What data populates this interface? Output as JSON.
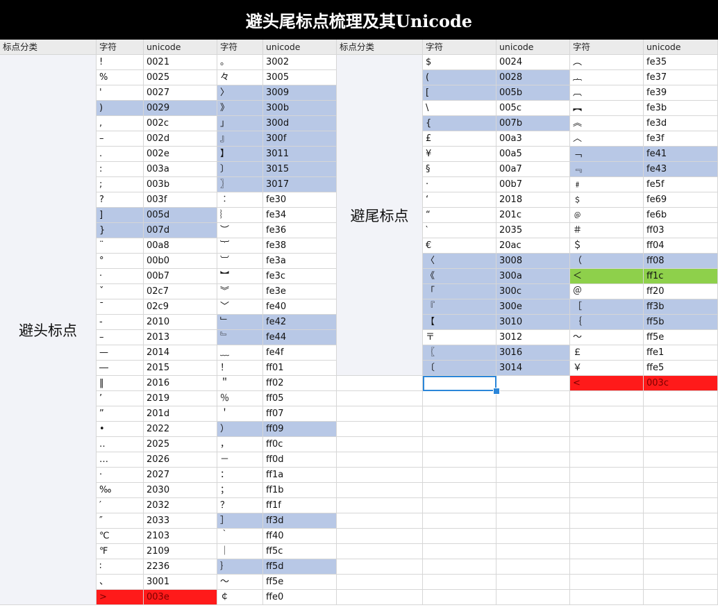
{
  "title": "避头尾标点梳理及其Unicode",
  "headers": {
    "category": "标点分类",
    "char": "字符",
    "unicode": "unicode"
  },
  "head_block": {
    "label": "避头标点",
    "col1": [
      [
        "!",
        "0021",
        ""
      ],
      [
        "%",
        "0025",
        ""
      ],
      [
        "'",
        "0027",
        ""
      ],
      [
        ")",
        "0029",
        "sel"
      ],
      [
        ",",
        "002c",
        ""
      ],
      [
        "–",
        "002d",
        ""
      ],
      [
        ".",
        "002e",
        ""
      ],
      [
        ":",
        "003a",
        ""
      ],
      [
        ";",
        "003b",
        ""
      ],
      [
        "?",
        "003f",
        ""
      ],
      [
        "]",
        "005d",
        "sel"
      ],
      [
        "}",
        "007d",
        "sel"
      ],
      [
        "¨",
        "00a8",
        ""
      ],
      [
        "°",
        "00b0",
        ""
      ],
      [
        "·",
        "00b7",
        ""
      ],
      [
        "ˇ",
        "02c7",
        ""
      ],
      [
        "ˉ",
        "02c9",
        ""
      ],
      [
        "‐",
        "2010",
        ""
      ],
      [
        "–",
        "2013",
        ""
      ],
      [
        "—",
        "2014",
        ""
      ],
      [
        "―",
        "2015",
        ""
      ],
      [
        "‖",
        "2016",
        ""
      ],
      [
        "’",
        "2019",
        ""
      ],
      [
        "”",
        "201d",
        ""
      ],
      [
        "•",
        "2022",
        ""
      ],
      [
        "‥",
        "2025",
        ""
      ],
      [
        "…",
        "2026",
        ""
      ],
      [
        "‧",
        "2027",
        ""
      ],
      [
        "‰",
        "2030",
        ""
      ],
      [
        "′",
        "2032",
        ""
      ],
      [
        "″",
        "2033",
        ""
      ],
      [
        "℃",
        "2103",
        ""
      ],
      [
        "℉",
        "2109",
        ""
      ],
      [
        "∶",
        "2236",
        ""
      ],
      [
        "、",
        "3001",
        ""
      ],
      [
        ">",
        "003e",
        "red"
      ]
    ],
    "col2": [
      [
        "。",
        "3002",
        ""
      ],
      [
        "々",
        "3005",
        ""
      ],
      [
        "〉",
        "3009",
        "sel"
      ],
      [
        "》",
        "300b",
        "sel"
      ],
      [
        "」",
        "300d",
        "sel"
      ],
      [
        "』",
        "300f",
        "sel"
      ],
      [
        "】",
        "3011",
        "sel"
      ],
      [
        "〕",
        "3015",
        "sel"
      ],
      [
        "〗",
        "3017",
        "sel"
      ],
      [
        "︰",
        "fe30",
        ""
      ],
      [
        "︴",
        "fe34",
        ""
      ],
      [
        "︶",
        "fe36",
        ""
      ],
      [
        "︸",
        "fe38",
        ""
      ],
      [
        "︺",
        "fe3a",
        ""
      ],
      [
        "︼",
        "fe3c",
        ""
      ],
      [
        "︾",
        "fe3e",
        ""
      ],
      [
        "﹀",
        "fe40",
        ""
      ],
      [
        "﹂",
        "fe42",
        "sel"
      ],
      [
        "﹄",
        "fe44",
        "sel"
      ],
      [
        "﹏",
        "fe4f",
        ""
      ],
      [
        "！",
        "ff01",
        ""
      ],
      [
        "＂",
        "ff02",
        ""
      ],
      [
        "％",
        "ff05",
        ""
      ],
      [
        "＇",
        "ff07",
        ""
      ],
      [
        "）",
        "ff09",
        "sel"
      ],
      [
        "，",
        "ff0c",
        ""
      ],
      [
        "－",
        "ff0d",
        ""
      ],
      [
        "：",
        "ff1a",
        ""
      ],
      [
        "；",
        "ff1b",
        ""
      ],
      [
        "？",
        "ff1f",
        ""
      ],
      [
        "］",
        "ff3d",
        "sel"
      ],
      [
        "｀",
        "ff40",
        ""
      ],
      [
        "｜",
        "ff5c",
        ""
      ],
      [
        "｝",
        "ff5d",
        "sel"
      ],
      [
        "～",
        "ff5e",
        ""
      ],
      [
        "￠",
        "ffe0",
        ""
      ]
    ]
  },
  "tail_block": {
    "label": "避尾标点",
    "col1": [
      [
        "$",
        "0024",
        ""
      ],
      [
        "(",
        "0028",
        "sel"
      ],
      [
        "[",
        "005b",
        "sel"
      ],
      [
        "\\",
        "005c",
        ""
      ],
      [
        "{",
        "007b",
        "sel"
      ],
      [
        "£",
        "00a3",
        ""
      ],
      [
        "¥",
        "00a5",
        ""
      ],
      [
        "§",
        "00a7",
        ""
      ],
      [
        "·",
        "00b7",
        ""
      ],
      [
        "‘",
        "2018",
        ""
      ],
      [
        "“",
        "201c",
        ""
      ],
      [
        "‵",
        "2035",
        ""
      ],
      [
        "€",
        "20ac",
        ""
      ],
      [
        "〈",
        "3008",
        "sel"
      ],
      [
        "《",
        "300a",
        "sel"
      ],
      [
        "「",
        "300c",
        "sel"
      ],
      [
        "『",
        "300e",
        "sel"
      ],
      [
        "【",
        "3010",
        "sel"
      ],
      [
        "〒",
        "3012",
        ""
      ],
      [
        "〖",
        "3016",
        "sel"
      ],
      [
        "〔",
        "3014",
        "sel"
      ]
    ],
    "col2": [
      [
        "︵",
        "fe35",
        ""
      ],
      [
        "︷",
        "fe37",
        ""
      ],
      [
        "︹",
        "fe39",
        ""
      ],
      [
        "︻",
        "fe3b",
        ""
      ],
      [
        "︽",
        "fe3d",
        ""
      ],
      [
        "︿",
        "fe3f",
        ""
      ],
      [
        "﹁",
        "fe41",
        "sel"
      ],
      [
        "﹃",
        "fe43",
        "sel"
      ],
      [
        "﹟",
        "fe5f",
        ""
      ],
      [
        "﹩",
        "fe69",
        ""
      ],
      [
        "﹫",
        "fe6b",
        ""
      ],
      [
        "＃",
        "ff03",
        ""
      ],
      [
        "＄",
        "ff04",
        ""
      ],
      [
        "（",
        "ff08",
        "sel"
      ],
      [
        "＜",
        "ff1c",
        "grn"
      ],
      [
        "＠",
        "ff20",
        ""
      ],
      [
        "［",
        "ff3b",
        "sel"
      ],
      [
        "｛",
        "ff5b",
        "sel"
      ],
      [
        "～",
        "ff5e",
        ""
      ],
      [
        "￡",
        "ffe1",
        ""
      ],
      [
        "￥",
        "ffe5",
        ""
      ],
      [
        "<",
        "003c",
        "red"
      ]
    ]
  }
}
